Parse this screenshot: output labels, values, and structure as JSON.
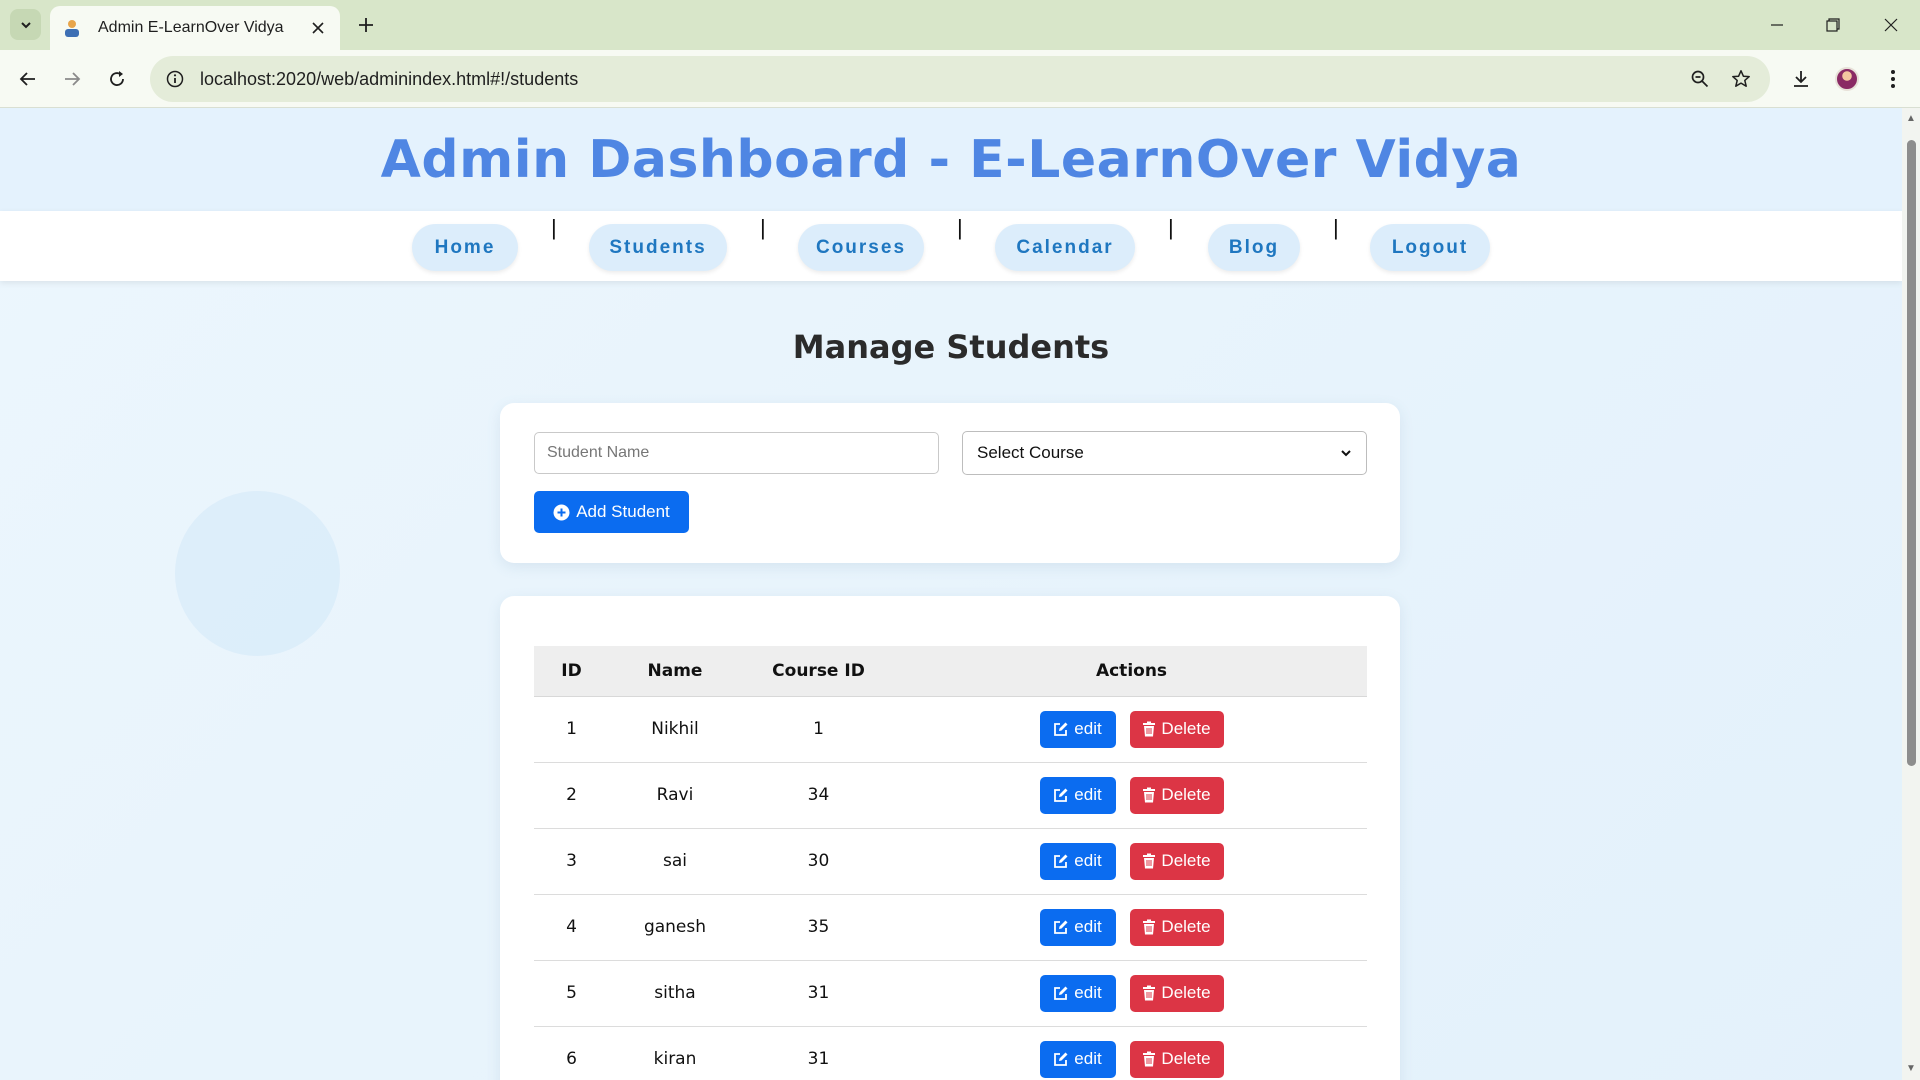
{
  "browser": {
    "tab_title": "Admin E-LearnOver Vidya",
    "url": "localhost:2020/web/adminindex.html#!/students"
  },
  "header": {
    "title": "Admin Dashboard - E-LearnOver Vidya"
  },
  "nav": {
    "items": [
      "Home",
      "Students",
      "Courses",
      "Calendar",
      "Blog",
      "Logout"
    ],
    "separator": "|"
  },
  "page": {
    "title": "Manage Students"
  },
  "form": {
    "name_placeholder": "Student Name",
    "course_select": "Select Course",
    "add_label": "Add Student"
  },
  "table": {
    "headers": {
      "id": "ID",
      "name": "Name",
      "course_id": "Course ID",
      "actions": "Actions"
    },
    "edit_label": "edit",
    "delete_label": "Delete",
    "rows": [
      {
        "id": "1",
        "name": "Nikhil",
        "course_id": "1"
      },
      {
        "id": "2",
        "name": "Ravi",
        "course_id": "34"
      },
      {
        "id": "3",
        "name": "sai",
        "course_id": "30"
      },
      {
        "id": "4",
        "name": "ganesh",
        "course_id": "35"
      },
      {
        "id": "5",
        "name": "sitha",
        "course_id": "31"
      },
      {
        "id": "6",
        "name": "kiran",
        "course_id": "31"
      }
    ]
  },
  "colors": {
    "primary": "#0b6cf0",
    "danger": "#dc3545",
    "heading": "#4f86e3",
    "nav_text": "#1f77c0"
  }
}
